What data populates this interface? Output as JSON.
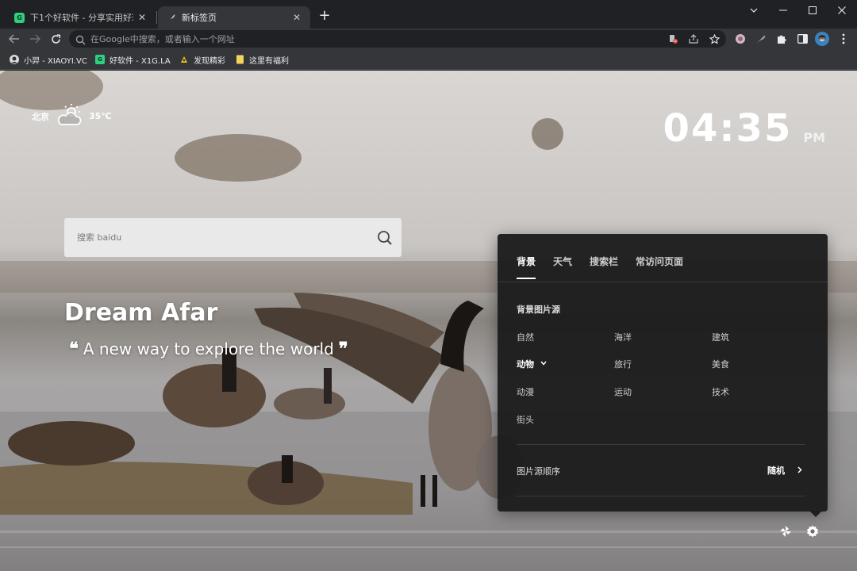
{
  "tabs": [
    {
      "label": "下1个好软件 - 分享实用好玩有趣",
      "favicon": "green-square-icon",
      "active": false
    },
    {
      "label": "新标签页",
      "favicon": "feather-icon",
      "active": true
    }
  ],
  "address_bar": {
    "placeholder": "在Google中搜索，或者输入一个网址"
  },
  "bookmarks": [
    {
      "label": "小羿 - XIAOYI.VC",
      "icon": "avatar-icon"
    },
    {
      "label": "好软件 - X1G.LA",
      "icon": "green-square-icon"
    },
    {
      "label": "发现精彩",
      "icon": "sparkle-icon"
    },
    {
      "label": "这里有福利",
      "icon": "folder-icon"
    }
  ],
  "weather": {
    "city": "北京",
    "temp": "35℃",
    "icon": "cloud-sun-icon"
  },
  "clock": {
    "time": "04:35",
    "ampm": "PM"
  },
  "search": {
    "placeholder": "搜索 baidu"
  },
  "slogan": {
    "brand": "Dream Afar",
    "tagline": "A new way to explore the world",
    "open_quote": "❝",
    "close_quote": "❞"
  },
  "settings": {
    "tabs": [
      "背景",
      "天气",
      "搜索栏",
      "常访问页面"
    ],
    "active_tab": 0,
    "source_title": "背景图片源",
    "categories": [
      "自然",
      "海洋",
      "建筑",
      "动物",
      "旅行",
      "美食",
      "动漫",
      "运动",
      "技术",
      "街头"
    ],
    "selected_category": "动物",
    "order_label": "图片源顺序",
    "order_value": "随机"
  },
  "colors": {
    "chrome_dark": "#202124",
    "chrome_toolbar": "#35363a",
    "panel": "#1c1c1d",
    "accent_text": "#ffffff"
  }
}
